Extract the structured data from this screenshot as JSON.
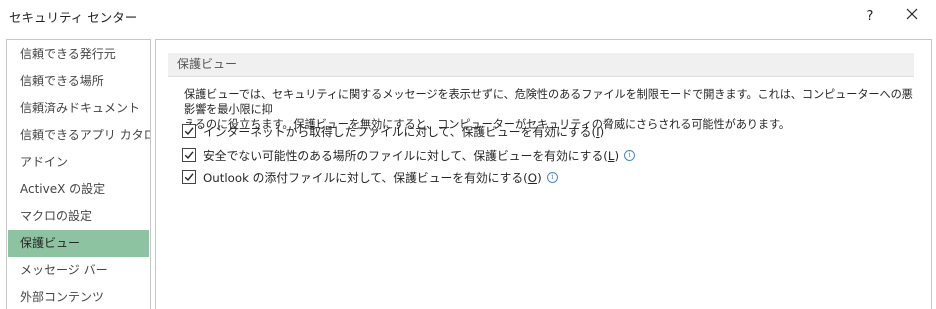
{
  "window": {
    "title": "セキュリティ センター",
    "help_label": "?",
    "close_label": "✕"
  },
  "sidebar": {
    "items": [
      {
        "label": "信頼できる発行元",
        "selected": false
      },
      {
        "label": "信頼できる場所",
        "selected": false
      },
      {
        "label": "信頼済みドキュメント",
        "selected": false
      },
      {
        "label": "信頼できるアプリ カタログ",
        "selected": false
      },
      {
        "label": "アドイン",
        "selected": false
      },
      {
        "label": "ActiveX の設定",
        "selected": false
      },
      {
        "label": "マクロの設定",
        "selected": false
      },
      {
        "label": "保護ビュー",
        "selected": true
      },
      {
        "label": "メッセージ バー",
        "selected": false
      },
      {
        "label": "外部コンテンツ",
        "selected": false
      }
    ],
    "selected_color": "#8dc3a1"
  },
  "main": {
    "section_title": "保護ビュー",
    "description_line1": "保護ビューでは、セキュリティに関するメッセージを表示せずに、危険性のあるファイルを制限モードで開きます。これは、コンピューターへの悪影響を最小限に抑",
    "description_line2": "えるのに役立ちます。保護ビューを無効にすると、コンピューターがセキュリティの脅威にさらされる可能性があります。",
    "options": [
      {
        "text": "インターネットから取得したファイルに対して、保護ビューを有効にする(",
        "key": "I",
        "suffix": ")",
        "checked": true,
        "info": false
      },
      {
        "text": "安全でない可能性のある場所のファイルに対して、保護ビューを有効にする(",
        "key": "L",
        "suffix": ")",
        "checked": true,
        "info": true
      },
      {
        "text": "Outlook の添付ファイルに対して、保護ビューを有効にする(",
        "key": "O",
        "suffix": ")",
        "checked": true,
        "info": true
      }
    ],
    "info_icon_glyph": "i"
  }
}
